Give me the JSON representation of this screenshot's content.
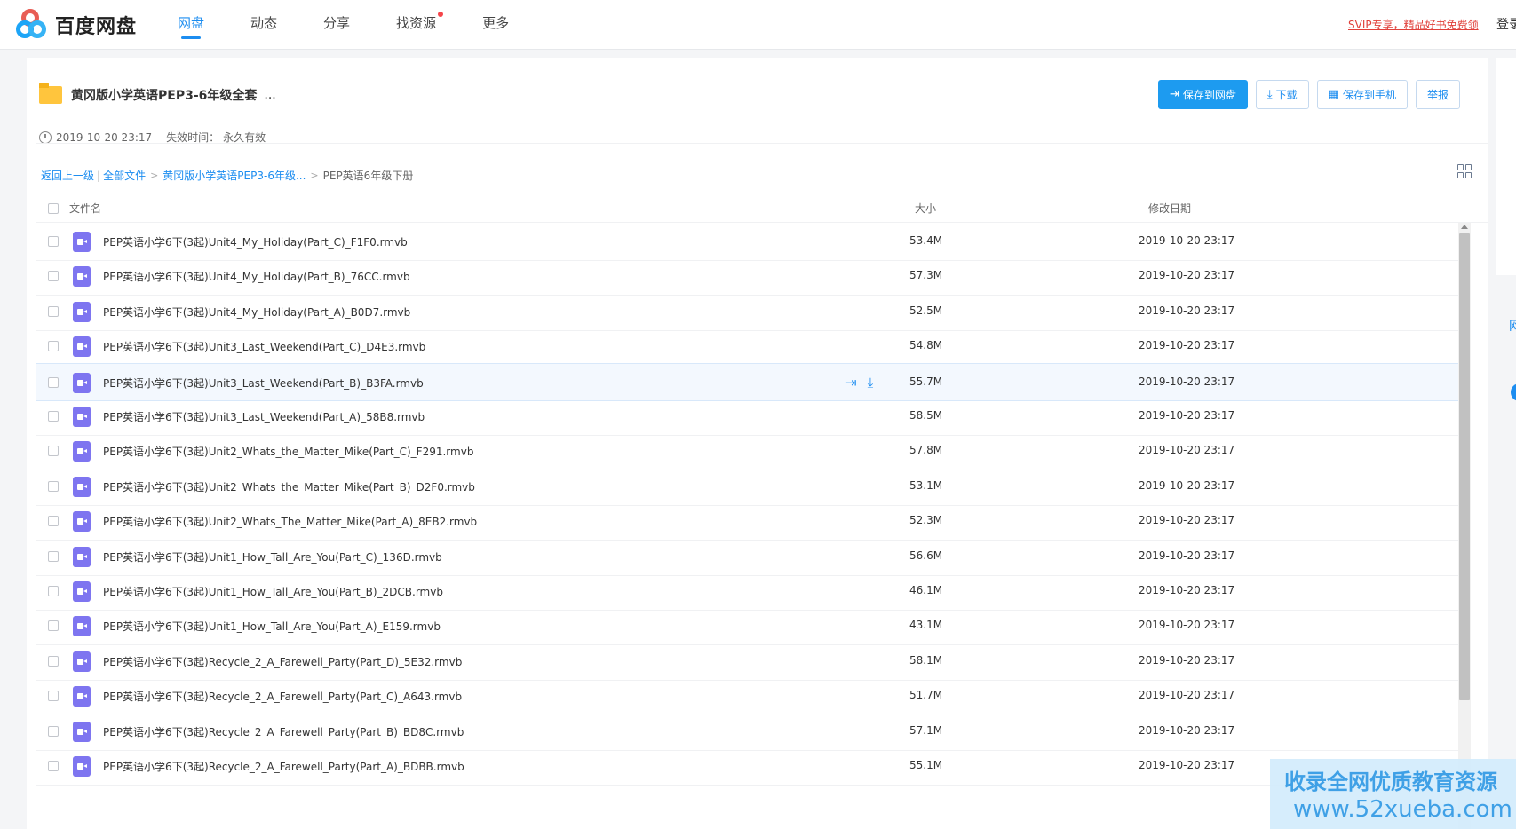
{
  "header": {
    "logo_text": "百度网盘",
    "nav": [
      {
        "label": "网盘",
        "active": true
      },
      {
        "label": "动态",
        "active": false
      },
      {
        "label": "分享",
        "active": false
      },
      {
        "label": "找资源",
        "active": false,
        "dot": true
      },
      {
        "label": "更多",
        "active": false
      }
    ],
    "svip_link": "SVIP专享，精品好书免费领",
    "login": "登录"
  },
  "share": {
    "title": "黄冈版小学英语PEP3-6年级全套",
    "title_ellipsis": "...",
    "created": "2019-10-20 23:17",
    "expire_label": "失效时间：",
    "expire_value": "永久有效"
  },
  "actions": {
    "save": "保存到网盘",
    "download": "下载",
    "save_phone": "保存到手机",
    "report": "举报"
  },
  "breadcrumb": {
    "back": "返回上一级",
    "all": "全部文件",
    "parent": "黄冈版小学英语PEP3-6年级...",
    "current": "PEP英语6年级下册",
    "separator": "|",
    "chevron": ">"
  },
  "table": {
    "col_name": "文件名",
    "col_size": "大小",
    "col_date": "修改日期",
    "rows": [
      {
        "name": "PEP英语小学6下(3起)Unit4_My_Holiday(Part_C)_F1F0.rmvb",
        "size": "53.4M",
        "date": "2019-10-20 23:17"
      },
      {
        "name": "PEP英语小学6下(3起)Unit4_My_Holiday(Part_B)_76CC.rmvb",
        "size": "57.3M",
        "date": "2019-10-20 23:17"
      },
      {
        "name": "PEP英语小学6下(3起)Unit4_My_Holiday(Part_A)_B0D7.rmvb",
        "size": "52.5M",
        "date": "2019-10-20 23:17"
      },
      {
        "name": "PEP英语小学6下(3起)Unit3_Last_Weekend(Part_C)_D4E3.rmvb",
        "size": "54.8M",
        "date": "2019-10-20 23:17"
      },
      {
        "name": "PEP英语小学6下(3起)Unit3_Last_Weekend(Part_B)_B3FA.rmvb",
        "size": "55.7M",
        "date": "2019-10-20 23:17"
      },
      {
        "name": "PEP英语小学6下(3起)Unit3_Last_Weekend(Part_A)_58B8.rmvb",
        "size": "58.5M",
        "date": "2019-10-20 23:17"
      },
      {
        "name": "PEP英语小学6下(3起)Unit2_Whats_the_Matter_Mike(Part_C)_F291.rmvb",
        "size": "57.8M",
        "date": "2019-10-20 23:17"
      },
      {
        "name": "PEP英语小学6下(3起)Unit2_Whats_the_Matter_Mike(Part_B)_D2F0.rmvb",
        "size": "53.1M",
        "date": "2019-10-20 23:17"
      },
      {
        "name": "PEP英语小学6下(3起)Unit2_Whats_The_Matter_Mike(Part_A)_8EB2.rmvb",
        "size": "52.3M",
        "date": "2019-10-20 23:17"
      },
      {
        "name": "PEP英语小学6下(3起)Unit1_How_Tall_Are_You(Part_C)_136D.rmvb",
        "size": "56.6M",
        "date": "2019-10-20 23:17"
      },
      {
        "name": "PEP英语小学6下(3起)Unit1_How_Tall_Are_You(Part_B)_2DCB.rmvb",
        "size": "46.1M",
        "date": "2019-10-20 23:17"
      },
      {
        "name": "PEP英语小学6下(3起)Unit1_How_Tall_Are_You(Part_A)_E159.rmvb",
        "size": "43.1M",
        "date": "2019-10-20 23:17"
      },
      {
        "name": "PEP英语小学6下(3起)Recycle_2_A_Farewell_Party(Part_D)_5E32.rmvb",
        "size": "58.1M",
        "date": "2019-10-20 23:17"
      },
      {
        "name": "PEP英语小学6下(3起)Recycle_2_A_Farewell_Party(Part_C)_A643.rmvb",
        "size": "51.7M",
        "date": "2019-10-20 23:17"
      },
      {
        "name": "PEP英语小学6下(3起)Recycle_2_A_Farewell_Party(Part_B)_BD8C.rmvb",
        "size": "57.1M",
        "date": "2019-10-20 23:17"
      },
      {
        "name": "PEP英语小学6下(3起)Recycle_2_A_Farewell_Party(Part_A)_BDBB.rmvb",
        "size": "55.1M",
        "date": "2019-10-20 23:17"
      }
    ],
    "hover_row_index": 4,
    "file_icon": "video-file-icon",
    "row_action_icons": [
      "save-to-disk-icon",
      "download-icon"
    ]
  },
  "side": {
    "char": "网"
  },
  "watermark": {
    "line1": "收录全网优质教育资源",
    "line2": "www.52xueba.com"
  },
  "colors": {
    "accent": "#1c8df0",
    "primary_button": "#1d9bf0",
    "folder": "#ffc53d",
    "video_icon": "#7e75f0",
    "svip": "#e0403a"
  }
}
